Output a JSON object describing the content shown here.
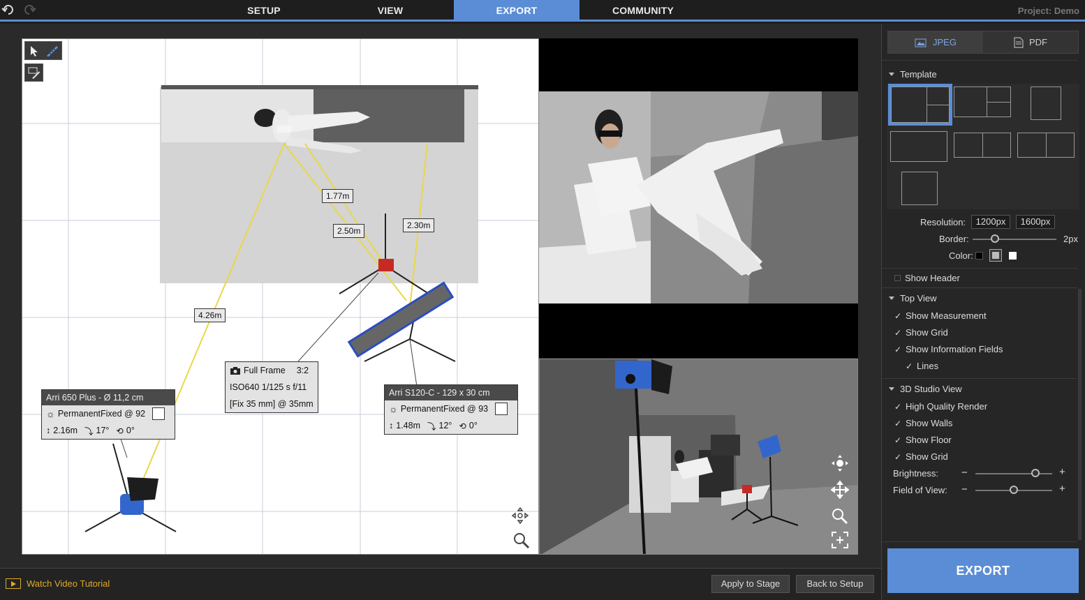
{
  "topbar": {
    "tabs": [
      {
        "label": "SETUP"
      },
      {
        "label": "VIEW"
      },
      {
        "label": "EXPORT"
      },
      {
        "label": "COMMUNITY"
      }
    ],
    "project": "Project: Demo"
  },
  "topview": {
    "distances": [
      "1.77m",
      "2.50m",
      "2.30m",
      "4.26m"
    ],
    "camera_info": {
      "line1": "Full Frame",
      "ratio": "3:2",
      "line2": "ISO640  1/125 s f/11",
      "line3": "[Fix 35 mm] @ 35mm"
    },
    "light1": {
      "title": "Arri 650 Plus - Ø 11,2 cm",
      "mode": "PermanentFixed @ 92",
      "height": "2.16m",
      "tilt": "17°",
      "rot": "0°"
    },
    "light2": {
      "title": "Arri S120-C - 129 x 30 cm",
      "mode": "PermanentFixed @ 93",
      "height": "1.48m",
      "tilt": "12°",
      "rot": "0°"
    }
  },
  "bottombar": {
    "tutorial": "Watch Video Tutorial",
    "apply": "Apply to Stage",
    "back": "Back to Setup"
  },
  "panel": {
    "formats": [
      {
        "label": "JPEG"
      },
      {
        "label": "PDF"
      }
    ],
    "template_title": "Template",
    "resolution_label": "Resolution:",
    "resolutions": [
      "1200px",
      "1600px"
    ],
    "border_label": "Border:",
    "border_value": "2px",
    "border_fraction": 0.27,
    "color_label": "Color:",
    "show_header": "Show Header",
    "topview_title": "Top View",
    "topview_opts": [
      "Show Measurement",
      "Show Grid",
      "Show Information Fields"
    ],
    "lines": "Lines",
    "studio_title": "3D Studio View",
    "studio_opts": [
      "High Quality Render",
      "Show Walls",
      "Show Floor",
      "Show Grid"
    ],
    "brightness_label": "Brightness:",
    "brightness_fraction": 0.78,
    "fov_label": "Field of View:",
    "fov_fraction": 0.5,
    "export": "EXPORT"
  }
}
